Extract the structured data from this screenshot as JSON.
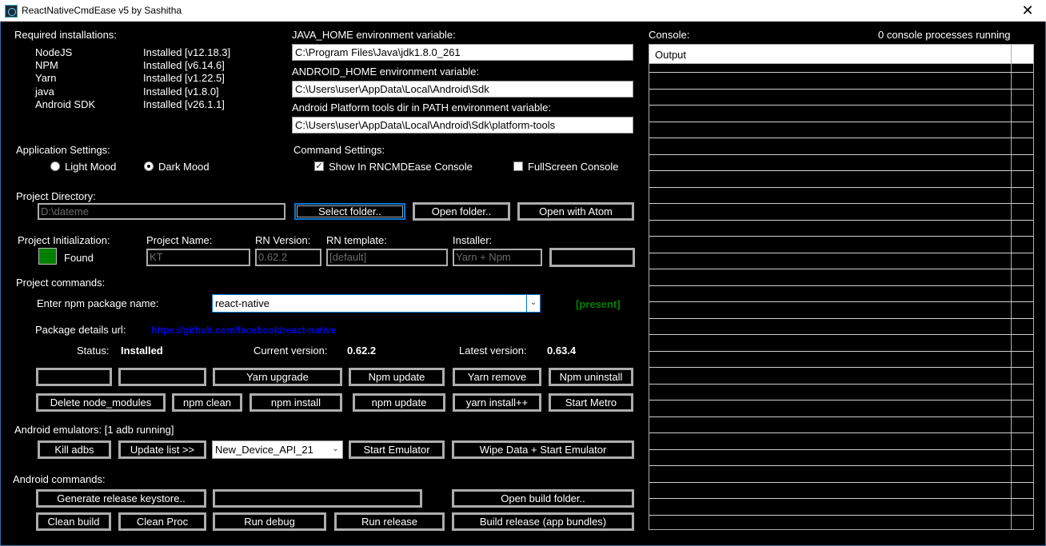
{
  "window": {
    "title": "ReactNativeCmdEase v5 by Sashitha",
    "close_glyph": "✕"
  },
  "required": {
    "heading": "Required installations:",
    "items": [
      {
        "name": "NodeJS",
        "status": "Installed [v12.18.3]"
      },
      {
        "name": "NPM",
        "status": "Installed [v6.14.6]"
      },
      {
        "name": "Yarn",
        "status": "Installed [v1.22.5]"
      },
      {
        "name": "java",
        "status": "Installed [v1.8.0]"
      },
      {
        "name": "Android SDK",
        "status": "Installed [v26.1.1]"
      }
    ]
  },
  "env": {
    "java_home_label": "JAVA_HOME environment variable:",
    "java_home_value": "C:\\Program Files\\Java\\jdk1.8.0_261",
    "android_home_label": "ANDROID_HOME environment variable:",
    "android_home_value": "C:\\Users\\user\\AppData\\Local\\Android\\Sdk",
    "platform_tools_label": "Android Platform tools dir in PATH environment variable:",
    "platform_tools_value": "C:\\Users\\user\\AppData\\Local\\Android\\Sdk\\platform-tools"
  },
  "app_settings": {
    "heading": "Application Settings:",
    "light": "Light Mood",
    "dark": "Dark Mood",
    "selected": "dark"
  },
  "cmd_settings": {
    "heading": "Command Settings:",
    "show_in_console": "Show In RNCMDEase Console",
    "show_checked": true,
    "fullscreen": "FullScreen Console",
    "fullscreen_checked": false
  },
  "project_dir": {
    "heading": "Project Directory:",
    "value": "D:\\dateme",
    "select": "Select folder..",
    "open": "Open folder..",
    "atom": "Open with Atom"
  },
  "project_init": {
    "heading": "Project Initialization:",
    "found": "Found",
    "status_color": "#008000",
    "name_label": "Project Name:",
    "name_value": "KT",
    "rn_version_label": "RN Version:",
    "rn_version_value": "0.62.2",
    "template_label": "RN template:",
    "template_value": "[default]",
    "installer_label": "Installer:",
    "installer_value": "Yarn + Npm",
    "extra_button": ""
  },
  "project_cmds": {
    "heading": "Project commands:",
    "npm_label": "Enter npm package name:",
    "npm_value": "react-native",
    "present": "[present]",
    "url_label": "Package details url:",
    "url_value": "https://github.com/facebook/react-native",
    "status_label": "Status:",
    "status_value": "Installed",
    "current_label": "Current version:",
    "current_value": "0.62.2",
    "latest_label": "Latest version:",
    "latest_value": "0.63.4",
    "row1": [
      "",
      "",
      "Yarn upgrade",
      "Npm update",
      "Yarn remove",
      "Npm uninstall"
    ],
    "row2": [
      "Delete node_modules",
      "npm clean",
      "npm install",
      "npm update",
      "yarn install++",
      "Start Metro"
    ]
  },
  "emulators": {
    "heading": "Android emulators: [1 adb running]",
    "kill": "Kill adbs",
    "update": "Update list >>",
    "device": "New_Device_API_21",
    "start": "Start Emulator",
    "wipe": "Wipe Data + Start Emulator"
  },
  "android_cmds": {
    "heading": "Android commands:",
    "row1": [
      "Generate release keystore..",
      "",
      "Open build folder.."
    ],
    "row2": [
      "Clean build",
      "Clean Proc",
      "Run debug",
      "Run release",
      "Build release (app bundles)"
    ]
  },
  "console": {
    "heading": "Console:",
    "processes": "0 console processes running",
    "column": "Output"
  }
}
